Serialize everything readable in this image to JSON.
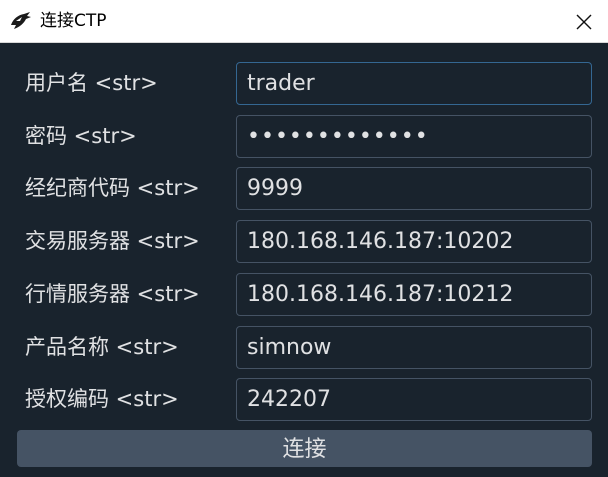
{
  "window": {
    "title": "连接CTP"
  },
  "form": {
    "fields": [
      {
        "label": "用户名 <str>",
        "value": "trader"
      },
      {
        "label": "密码 <str>",
        "value": "•••••••••••••"
      },
      {
        "label": "经纪商代码 <str>",
        "value": "9999"
      },
      {
        "label": "交易服务器 <str>",
        "value": "180.168.146.187:10202"
      },
      {
        "label": "行情服务器 <str>",
        "value": "180.168.146.187:10212"
      },
      {
        "label": "产品名称 <str>",
        "value": "simnow"
      },
      {
        "label": "授权编码 <str>",
        "value": "242207"
      }
    ],
    "connect_label": "连接"
  },
  "icons": {
    "app": "qt-app-icon",
    "close": "close-icon"
  },
  "colors": {
    "background": "#19232d",
    "border": "#455364",
    "focus_border": "#346792",
    "text": "#e0e1e3",
    "button": "#455364"
  }
}
